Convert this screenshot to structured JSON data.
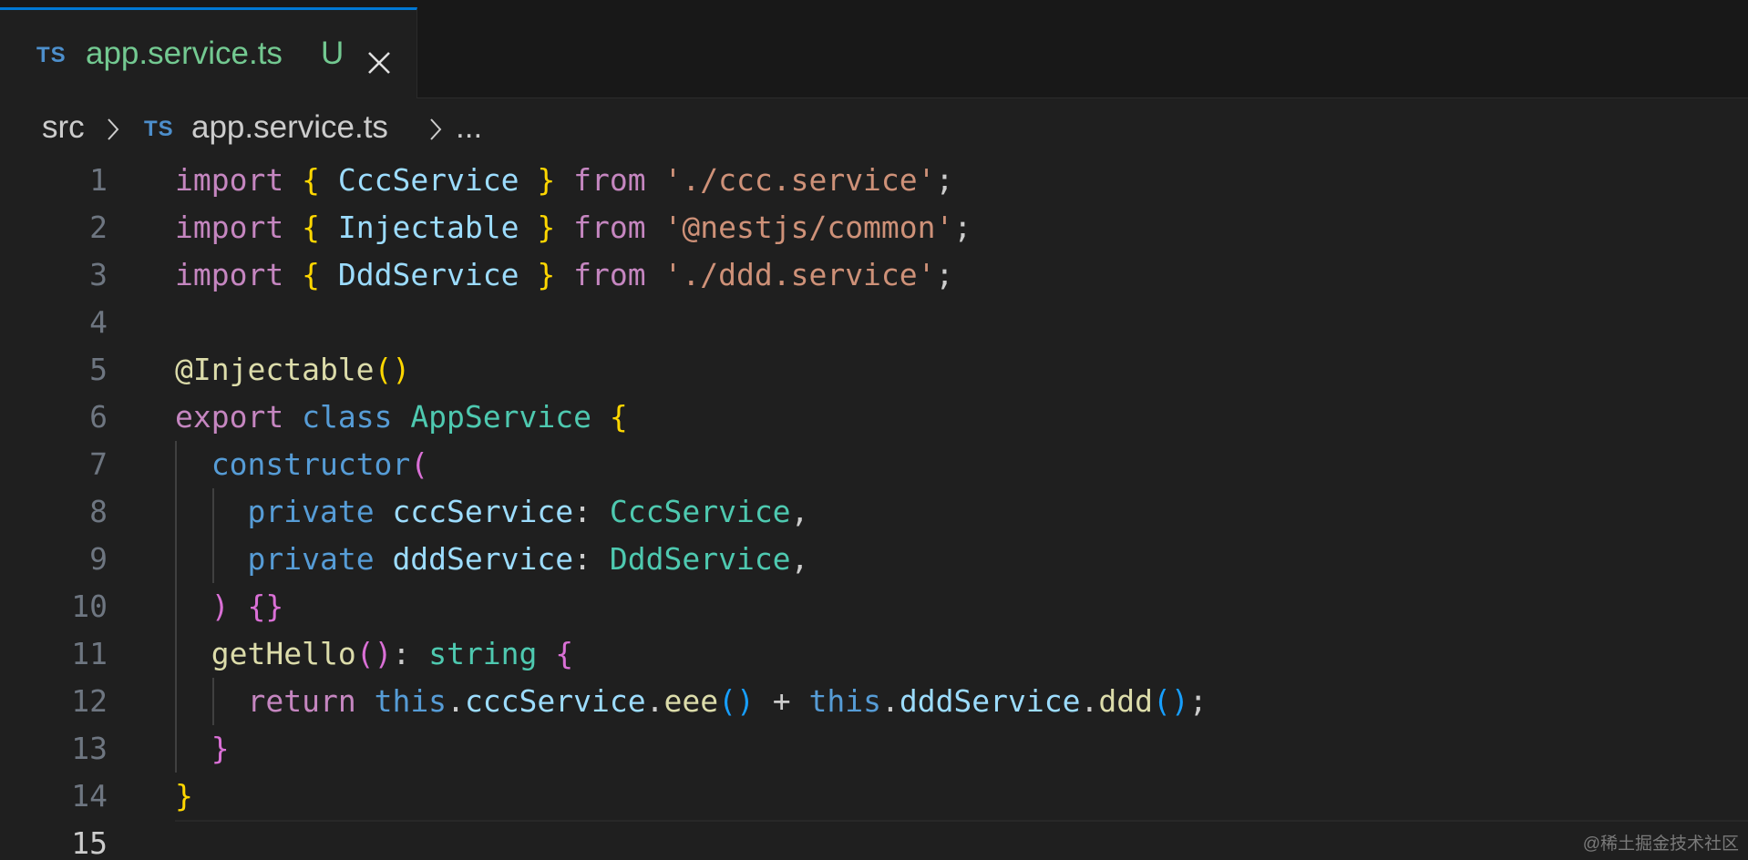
{
  "tab": {
    "icon": "TS",
    "filename": "app.service.ts",
    "status": "U",
    "close_icon": "close-icon"
  },
  "breadcrumb": {
    "folder": "src",
    "file_icon": "TS",
    "file": "app.service.ts",
    "more": "..."
  },
  "editor": {
    "current_line": 15,
    "lines": [
      {
        "n": "1",
        "tokens": [
          [
            "k",
            "import"
          ],
          [
            "p",
            " "
          ],
          [
            "y",
            "{"
          ],
          [
            "p",
            " "
          ],
          [
            "v",
            "CccService"
          ],
          [
            "p",
            " "
          ],
          [
            "y",
            "}"
          ],
          [
            "p",
            " "
          ],
          [
            "k",
            "from"
          ],
          [
            "p",
            " "
          ],
          [
            "s",
            "'./ccc.service'"
          ],
          [
            "p",
            ";"
          ]
        ]
      },
      {
        "n": "2",
        "tokens": [
          [
            "k",
            "import"
          ],
          [
            "p",
            " "
          ],
          [
            "y",
            "{"
          ],
          [
            "p",
            " "
          ],
          [
            "v",
            "Injectable"
          ],
          [
            "p",
            " "
          ],
          [
            "y",
            "}"
          ],
          [
            "p",
            " "
          ],
          [
            "k",
            "from"
          ],
          [
            "p",
            " "
          ],
          [
            "s",
            "'@nestjs/common'"
          ],
          [
            "p",
            ";"
          ]
        ]
      },
      {
        "n": "3",
        "tokens": [
          [
            "k",
            "import"
          ],
          [
            "p",
            " "
          ],
          [
            "y",
            "{"
          ],
          [
            "p",
            " "
          ],
          [
            "v",
            "DddService"
          ],
          [
            "p",
            " "
          ],
          [
            "y",
            "}"
          ],
          [
            "p",
            " "
          ],
          [
            "k",
            "from"
          ],
          [
            "p",
            " "
          ],
          [
            "s",
            "'./ddd.service'"
          ],
          [
            "p",
            ";"
          ]
        ]
      },
      {
        "n": "4",
        "tokens": []
      },
      {
        "n": "5",
        "tokens": [
          [
            "f",
            "@Injectable"
          ],
          [
            "y",
            "()"
          ]
        ]
      },
      {
        "n": "6",
        "tokens": [
          [
            "k",
            "export"
          ],
          [
            "p",
            " "
          ],
          [
            "b",
            "class"
          ],
          [
            "p",
            " "
          ],
          [
            "t",
            "AppService"
          ],
          [
            "p",
            " "
          ],
          [
            "y",
            "{"
          ]
        ]
      },
      {
        "n": "7",
        "tokens": [
          [
            "p",
            "  "
          ],
          [
            "b",
            "constructor"
          ],
          [
            "m",
            "("
          ]
        ]
      },
      {
        "n": "8",
        "tokens": [
          [
            "p",
            "    "
          ],
          [
            "b",
            "private"
          ],
          [
            "p",
            " "
          ],
          [
            "v",
            "cccService"
          ],
          [
            "p",
            ": "
          ],
          [
            "t",
            "CccService"
          ],
          [
            "p",
            ","
          ]
        ]
      },
      {
        "n": "9",
        "tokens": [
          [
            "p",
            "    "
          ],
          [
            "b",
            "private"
          ],
          [
            "p",
            " "
          ],
          [
            "v",
            "dddService"
          ],
          [
            "p",
            ": "
          ],
          [
            "t",
            "DddService"
          ],
          [
            "p",
            ","
          ]
        ]
      },
      {
        "n": "10",
        "tokens": [
          [
            "p",
            "  "
          ],
          [
            "m",
            ")"
          ],
          [
            "p",
            " "
          ],
          [
            "m",
            "{}"
          ]
        ]
      },
      {
        "n": "11",
        "tokens": [
          [
            "p",
            "  "
          ],
          [
            "f",
            "getHello"
          ],
          [
            "m",
            "()"
          ],
          [
            "p",
            ": "
          ],
          [
            "t",
            "string"
          ],
          [
            "p",
            " "
          ],
          [
            "m",
            "{"
          ]
        ]
      },
      {
        "n": "12",
        "tokens": [
          [
            "p",
            "    "
          ],
          [
            "k",
            "return"
          ],
          [
            "p",
            " "
          ],
          [
            "b",
            "this"
          ],
          [
            "p",
            "."
          ],
          [
            "v",
            "cccService"
          ],
          [
            "p",
            "."
          ],
          [
            "f",
            "eee"
          ],
          [
            "l",
            "()"
          ],
          [
            "p",
            " + "
          ],
          [
            "b",
            "this"
          ],
          [
            "p",
            "."
          ],
          [
            "v",
            "dddService"
          ],
          [
            "p",
            "."
          ],
          [
            "f",
            "ddd"
          ],
          [
            "l",
            "()"
          ],
          [
            "p",
            ";"
          ]
        ]
      },
      {
        "n": "13",
        "tokens": [
          [
            "p",
            "  "
          ],
          [
            "m",
            "}"
          ]
        ]
      },
      {
        "n": "14",
        "tokens": [
          [
            "y",
            "}"
          ]
        ]
      },
      {
        "n": "15",
        "tokens": []
      }
    ]
  },
  "watermark": "@稀土掘金技术社区",
  "colors": {
    "accent": "#0078d4",
    "untracked": "#73c991",
    "keyword": "#c586c0",
    "storage": "#569cd6",
    "variable": "#9cdcfe",
    "type": "#4ec9b0",
    "string": "#ce9178",
    "function": "#dcdcaa"
  }
}
